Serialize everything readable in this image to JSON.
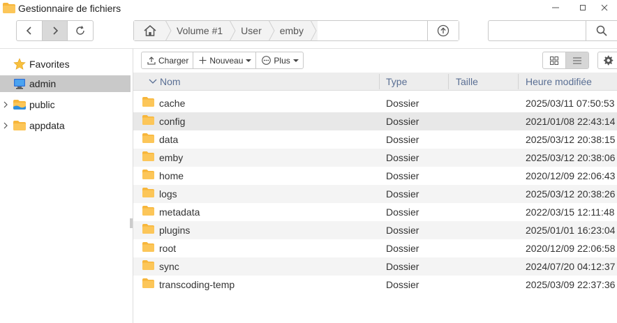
{
  "window": {
    "title": "Gestionnaire de fichiers"
  },
  "breadcrumb": [
    "Volume #1",
    "User",
    "emby"
  ],
  "search": {
    "placeholder": "",
    "value": ""
  },
  "sidebar": {
    "items": [
      {
        "label": "Favorites",
        "icon": "star-icon",
        "expandable": false,
        "selected": false
      },
      {
        "label": "admin",
        "icon": "computer-icon",
        "expandable": false,
        "selected": true
      },
      {
        "label": "public",
        "icon": "shared-folder-icon",
        "expandable": true,
        "selected": false
      },
      {
        "label": "appdata",
        "icon": "folder-icon",
        "expandable": true,
        "selected": false
      }
    ]
  },
  "actions": {
    "upload_label": "Charger",
    "new_label": "Nouveau",
    "more_label": "Plus"
  },
  "table": {
    "columns": {
      "name": "Nom",
      "type": "Type",
      "size": "Taille",
      "modified": "Heure modifiée"
    },
    "rows": [
      {
        "name": "cache",
        "type": "Dossier",
        "size": "",
        "modified": "2025/03/11 07:50:53"
      },
      {
        "name": "config",
        "type": "Dossier",
        "size": "",
        "modified": "2021/01/08 22:43:14"
      },
      {
        "name": "data",
        "type": "Dossier",
        "size": "",
        "modified": "2025/03/12 20:38:15"
      },
      {
        "name": "emby",
        "type": "Dossier",
        "size": "",
        "modified": "2025/03/12 20:38:06"
      },
      {
        "name": "home",
        "type": "Dossier",
        "size": "",
        "modified": "2020/12/09 22:06:43"
      },
      {
        "name": "logs",
        "type": "Dossier",
        "size": "",
        "modified": "2025/03/12 20:38:26"
      },
      {
        "name": "metadata",
        "type": "Dossier",
        "size": "",
        "modified": "2022/03/15 12:11:48"
      },
      {
        "name": "plugins",
        "type": "Dossier",
        "size": "",
        "modified": "2025/01/01 16:23:04"
      },
      {
        "name": "root",
        "type": "Dossier",
        "size": "",
        "modified": "2020/12/09 22:06:58"
      },
      {
        "name": "sync",
        "type": "Dossier",
        "size": "",
        "modified": "2024/07/20 04:12:37"
      },
      {
        "name": "transcoding-temp",
        "type": "Dossier",
        "size": "",
        "modified": "2025/03/09 22:37:36"
      }
    ]
  },
  "colors": {
    "folder": "#f7b63b",
    "header_text": "#5a6f94",
    "selected_bg": "#c9c9c9"
  }
}
